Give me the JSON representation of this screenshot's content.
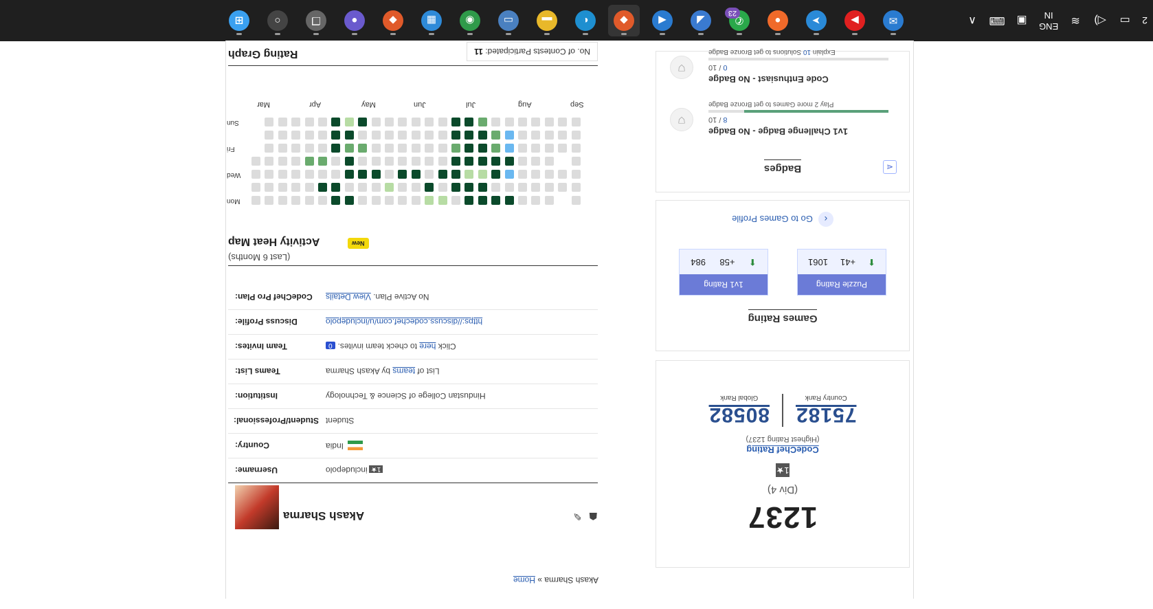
{
  "taskbar": {
    "lang_top": "ENG",
    "lang_bottom": "IN",
    "clock_partial": "2",
    "apps": [
      {
        "name": "windows-start",
        "glyph": "⊞",
        "color": "#3aa0f0",
        "active": false
      },
      {
        "name": "search",
        "glyph": "○",
        "color": "#444",
        "active": false
      },
      {
        "name": "task-view",
        "glyph": "❐",
        "color": "#666",
        "active": false
      },
      {
        "name": "meet",
        "glyph": "●",
        "color": "#6a5acd",
        "active": false
      },
      {
        "name": "brave-profile",
        "glyph": "◆",
        "color": "#e05a2a",
        "active": false
      },
      {
        "name": "store",
        "glyph": "▦",
        "color": "#2e8ad8",
        "active": false
      },
      {
        "name": "chrome",
        "glyph": "◉",
        "color": "#2f9a4a",
        "active": false
      },
      {
        "name": "monitor",
        "glyph": "▭",
        "color": "#4a80c0",
        "active": false
      },
      {
        "name": "files",
        "glyph": "▬",
        "color": "#e8b82a",
        "active": false
      },
      {
        "name": "edge",
        "glyph": "◐",
        "color": "#1e8fd0",
        "active": false
      },
      {
        "name": "brave-active",
        "glyph": "◆",
        "color": "#e05a2a",
        "active": true
      },
      {
        "name": "vscode",
        "glyph": "◀",
        "color": "#2a7bd0",
        "active": false
      },
      {
        "name": "dev-tool",
        "glyph": "◢",
        "color": "#3a7ad0",
        "active": false
      },
      {
        "name": "whatsapp",
        "glyph": "✆",
        "color": "#2aa84a",
        "active": false,
        "badge": "23"
      },
      {
        "name": "postman",
        "glyph": "●",
        "color": "#f06a2a",
        "active": false
      },
      {
        "name": "telegram",
        "glyph": "➤",
        "color": "#2a8ad8",
        "active": false
      },
      {
        "name": "youtube",
        "glyph": "▶",
        "color": "#e02020",
        "active": false
      },
      {
        "name": "mail",
        "glyph": "✉",
        "color": "#2a7bd0",
        "active": false
      }
    ]
  },
  "breadcrumb": {
    "home": "Home",
    "sep": " » ",
    "current": "Akash Sharma"
  },
  "rating": {
    "value": "1237",
    "division": "(Div 4)",
    "star": "1★",
    "label": "CodeChef Rating",
    "highest": "(Highest Rating 1237)",
    "global_rank": "80582",
    "global_rank_label": "Global Rank",
    "country_rank": "75182",
    "country_rank_label": "Country Rank"
  },
  "games": {
    "title": "Games Rating",
    "boxes": [
      {
        "label": "1v1 Rating",
        "value": "984",
        "delta": "+58"
      },
      {
        "label": "Puzzle Rating",
        "value": "1061",
        "delta": "+41"
      }
    ],
    "link": "Go to Games Profile"
  },
  "badges": {
    "title": "Badges",
    "items": [
      {
        "name": "1v1 Challenge Badge - No Badge",
        "done": "8",
        "total": "/ 10",
        "hint": "Play 2 more Games to get Bronze Badge",
        "fill": 0.8
      },
      {
        "name": "Code Enthusiast - No Badge",
        "done": "0",
        "total": "/ 10",
        "hint_prefix": "Explain ",
        "hint_num": "10",
        "hint_suffix": " Solutions to get Bronze Badge",
        "fill": 0.0
      }
    ]
  },
  "profile": {
    "name": "Akash Sharma",
    "rows": [
      {
        "key": "Username:",
        "star": "1★",
        "value": "includepolo"
      },
      {
        "key": "Country:",
        "value": "India"
      },
      {
        "key": "Student/Professional:",
        "value": "Student"
      },
      {
        "key": "Institution:",
        "value": "Hindustan College of Science & Technology"
      },
      {
        "key": "Teams List:",
        "pre": "List of ",
        "link": "teams",
        "post": " by Akash Sharma"
      },
      {
        "key": "Team Invites:",
        "pre": "Click ",
        "link": "here",
        "post": " to check team invites.",
        "count": "0"
      },
      {
        "key": "Discuss Profile:",
        "link": "https://discuss.codechef.com/u/includepolo"
      },
      {
        "key": "CodeChef Pro Plan:",
        "pre": "No Active Plan. ",
        "link": "View Details"
      }
    ]
  },
  "heatmap": {
    "title": "Activity Heat Map",
    "new_tag": "New",
    "subtitle": "(Last 6 Months)",
    "day_labels": [
      "Mon",
      "Wed",
      "Fri",
      "Sun"
    ],
    "months": [
      "Mar",
      "Apr",
      "May",
      "Jun",
      "Jul",
      "Aug",
      "Sep"
    ],
    "colors": {
      "0": "#dcdcdc",
      "1": "#b7dca4",
      "2": "#6aab6e",
      "3": "#0b4a2b",
      "4": "#6ab8f0",
      "5": "#ffffff"
    },
    "rows": [
      "0000003300000110333300050",
      "0000033000100303330000000",
      "0000000333033033113400000",
      "0000220300000003333300050",
      "5000003220000002332400000",
      "5000003300000003332400000",
      "5000003130000003320000000"
    ]
  },
  "rating_graph": {
    "title": "Rating Graph",
    "contests_label": "No. of Contests Participated: ",
    "contests_value": "11"
  }
}
